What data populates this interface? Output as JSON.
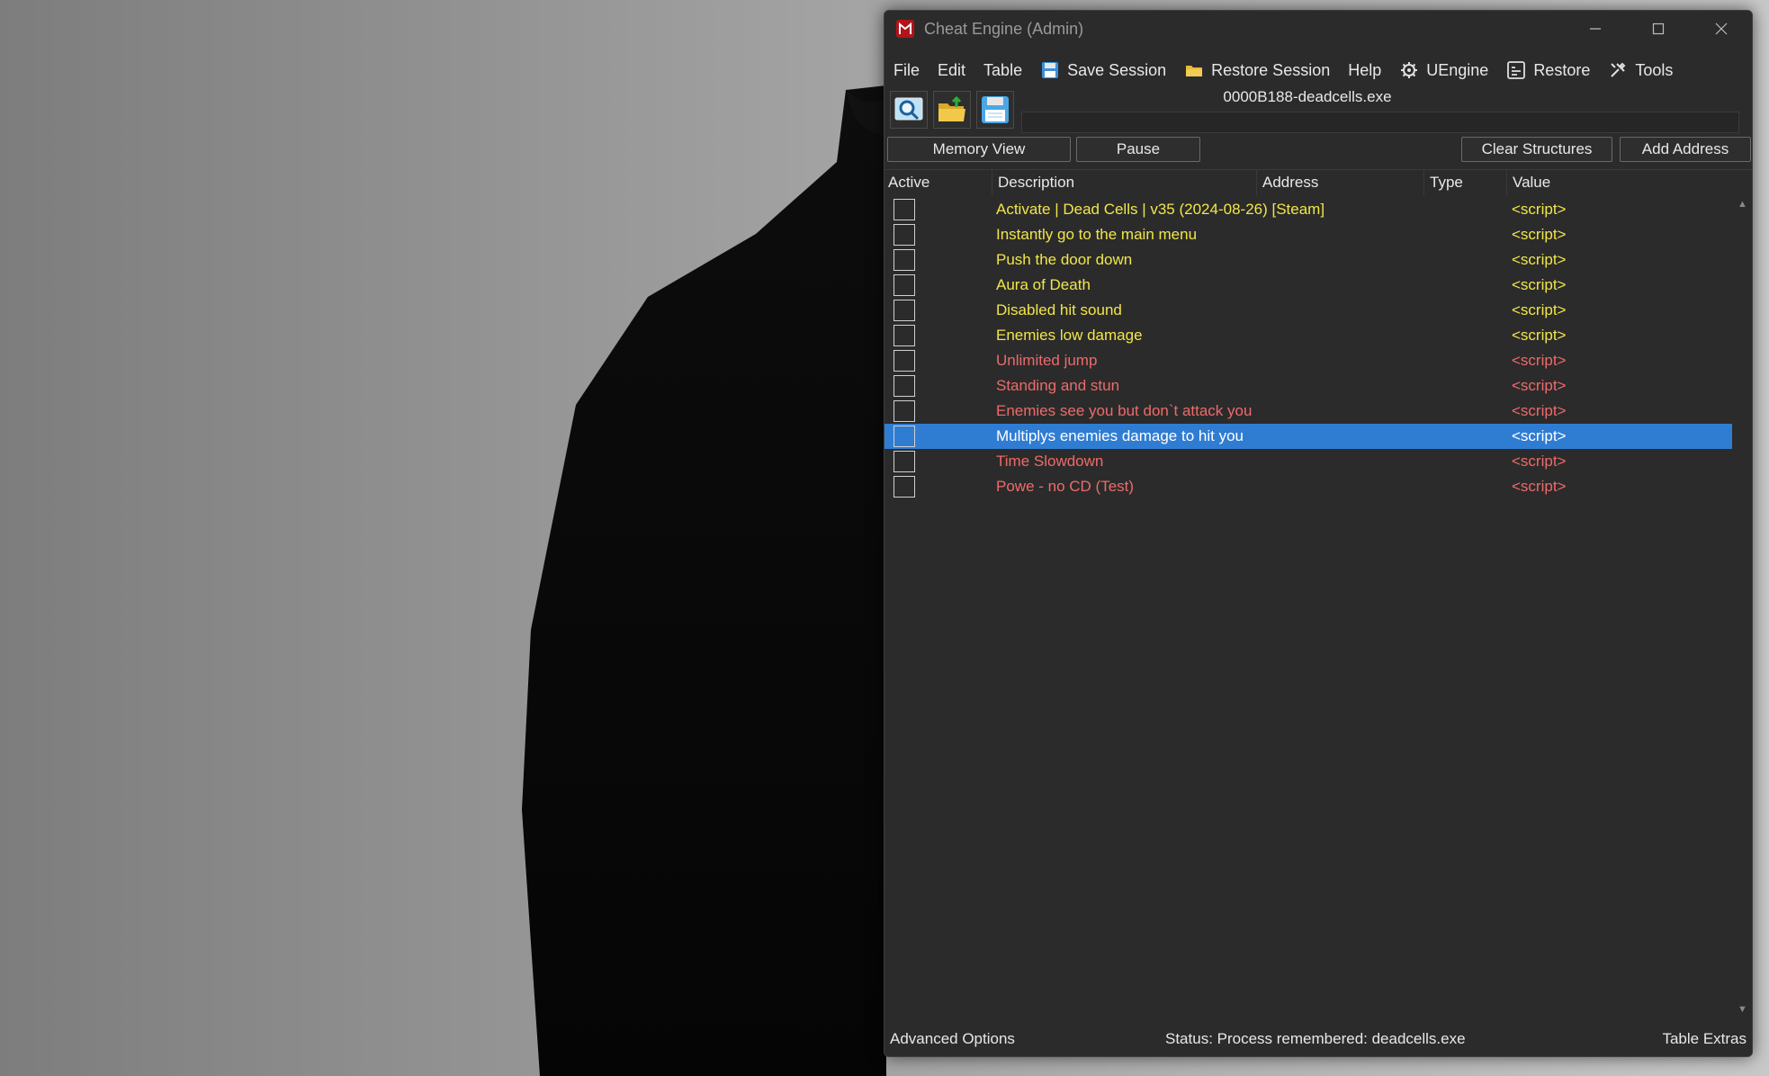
{
  "window": {
    "title": "Cheat Engine (Admin)"
  },
  "menu": {
    "file": "File",
    "edit": "Edit",
    "table": "Table",
    "save_session": "Save Session",
    "restore_session": "Restore Session",
    "help": "Help",
    "uengine": "UEngine",
    "restore": "Restore",
    "tools": "Tools"
  },
  "toolbar": {
    "process": "0000B188-deadcells.exe",
    "icons": [
      "process-select-icon",
      "open-folder-icon",
      "save-disk-icon"
    ]
  },
  "buttons": {
    "memory_view": "Memory View",
    "pause": "Pause",
    "clear_structures": "Clear Structures",
    "add_address": "Add Address"
  },
  "table": {
    "columns": {
      "active": "Active",
      "description": "Description",
      "address": "Address",
      "type": "Type",
      "value": "Value"
    },
    "rows": [
      {
        "description": "Activate | Dead Cells | v35 (2024-08-26) [Steam]",
        "value": "<script>",
        "color": "#f1e64a"
      },
      {
        "description": "Instantly go to the main menu",
        "value": "<script>",
        "color": "#f1e64a"
      },
      {
        "description": "Push the door down",
        "value": "<script>",
        "color": "#f1e64a"
      },
      {
        "description": "Aura of Death",
        "value": "<script>",
        "color": "#f1e64a"
      },
      {
        "description": "Disabled hit sound",
        "value": "<script>",
        "color": "#f1e64a"
      },
      {
        "description": "Enemies low damage",
        "value": "<script>",
        "color": "#f1e64a"
      },
      {
        "description": "Unlimited jump",
        "value": "<script>",
        "color": "#ee6a6a"
      },
      {
        "description": "Standing and stun",
        "value": "<script>",
        "color": "#ee6a6a"
      },
      {
        "description": "Enemies see you but don`t attack you",
        "value": "<script>",
        "color": "#ee6a6a"
      },
      {
        "description": "Multiplys enemies damage to hit you",
        "value": "<script>",
        "color": "#ee6a6a",
        "selected": true
      },
      {
        "description": "Time Slowdown",
        "value": "<script>",
        "color": "#ee6a6a"
      },
      {
        "description": "Powe - no CD (Test)",
        "value": "<script>",
        "color": "#ee6a6a"
      }
    ]
  },
  "statusbar": {
    "advanced_options": "Advanced Options",
    "status": "Status: Process remembered: deadcells.exe",
    "table_extras": "Table Extras"
  },
  "colors": {
    "window_bg": "#2b2b2b",
    "selection": "#2f7dd3",
    "enabled_script": "#f1e64a",
    "test_script": "#ee6a6a"
  }
}
